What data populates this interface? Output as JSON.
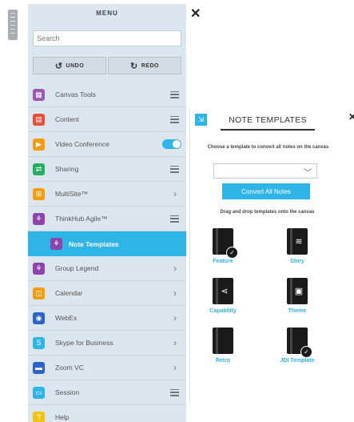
{
  "menu": {
    "title": "MENU",
    "close_glyph": "✕",
    "search_placeholder": "Search",
    "undo_label": "UNDO",
    "redo_label": "REDO",
    "items": [
      {
        "label": "Canvas Tools",
        "icon": "canvas-tools-icon",
        "color": "#9b59b6",
        "trail": "list"
      },
      {
        "label": "Content",
        "icon": "content-icon",
        "color": "#e74c3c",
        "trail": "list"
      },
      {
        "label": "Video Conference",
        "icon": "video-icon",
        "color": "#f39c12",
        "trail": "toggle"
      },
      {
        "label": "Sharing",
        "icon": "sharing-icon",
        "color": "#27ae60",
        "trail": "list"
      },
      {
        "label": "MultiSite™",
        "icon": "multisite-icon",
        "color": "#f39c12",
        "trail": "chevron"
      },
      {
        "label": "ThinkHub Agile™",
        "icon": "agile-icon",
        "color": "#8e44ad",
        "trail": "list"
      },
      {
        "label": "Note Templates",
        "icon": "note-templates-icon",
        "color": "#8e44ad",
        "trail": "none",
        "active": true
      },
      {
        "label": "Group Legend",
        "icon": "group-legend-icon",
        "color": "#8e44ad",
        "trail": "chevron"
      },
      {
        "label": "Calendar",
        "icon": "calendar-icon",
        "color": "#f39c12",
        "trail": "chevron"
      },
      {
        "label": "WebEx",
        "icon": "webex-icon",
        "color": "#2c62c9",
        "trail": "chevron"
      },
      {
        "label": "Skype for Business",
        "icon": "skype-icon",
        "color": "#2fb4e8",
        "trail": "chevron"
      },
      {
        "label": "Zoom VC",
        "icon": "zoom-icon",
        "color": "#2c62c9",
        "trail": "chevron"
      },
      {
        "label": "Session",
        "icon": "session-icon",
        "color": "#2fb4e8",
        "trail": "list"
      },
      {
        "label": "Help",
        "icon": "help-icon",
        "color": "#f1c40f",
        "trail": "none"
      }
    ]
  },
  "panel": {
    "title": "NOTE TEMPLATES",
    "close_glyph": "✕",
    "instruction": "Choose a template to convert all notes on the canvas",
    "select_value": "",
    "convert_label": "Convert All Notes",
    "drag_text": "Drag and drop templates onto the canvas",
    "templates": [
      {
        "name": "Feature",
        "icon": "feature-template-icon"
      },
      {
        "name": "Story",
        "icon": "story-template-icon"
      },
      {
        "name": "Capability",
        "icon": "capability-template-icon"
      },
      {
        "name": "Theme",
        "icon": "theme-template-icon"
      },
      {
        "name": "Retro",
        "icon": "retro-template-icon"
      },
      {
        "name": "JDI Template",
        "icon": "jdi-template-icon"
      }
    ]
  },
  "colors": {
    "accent": "#2fb4e8",
    "menu_bg": "#dce6ee"
  }
}
